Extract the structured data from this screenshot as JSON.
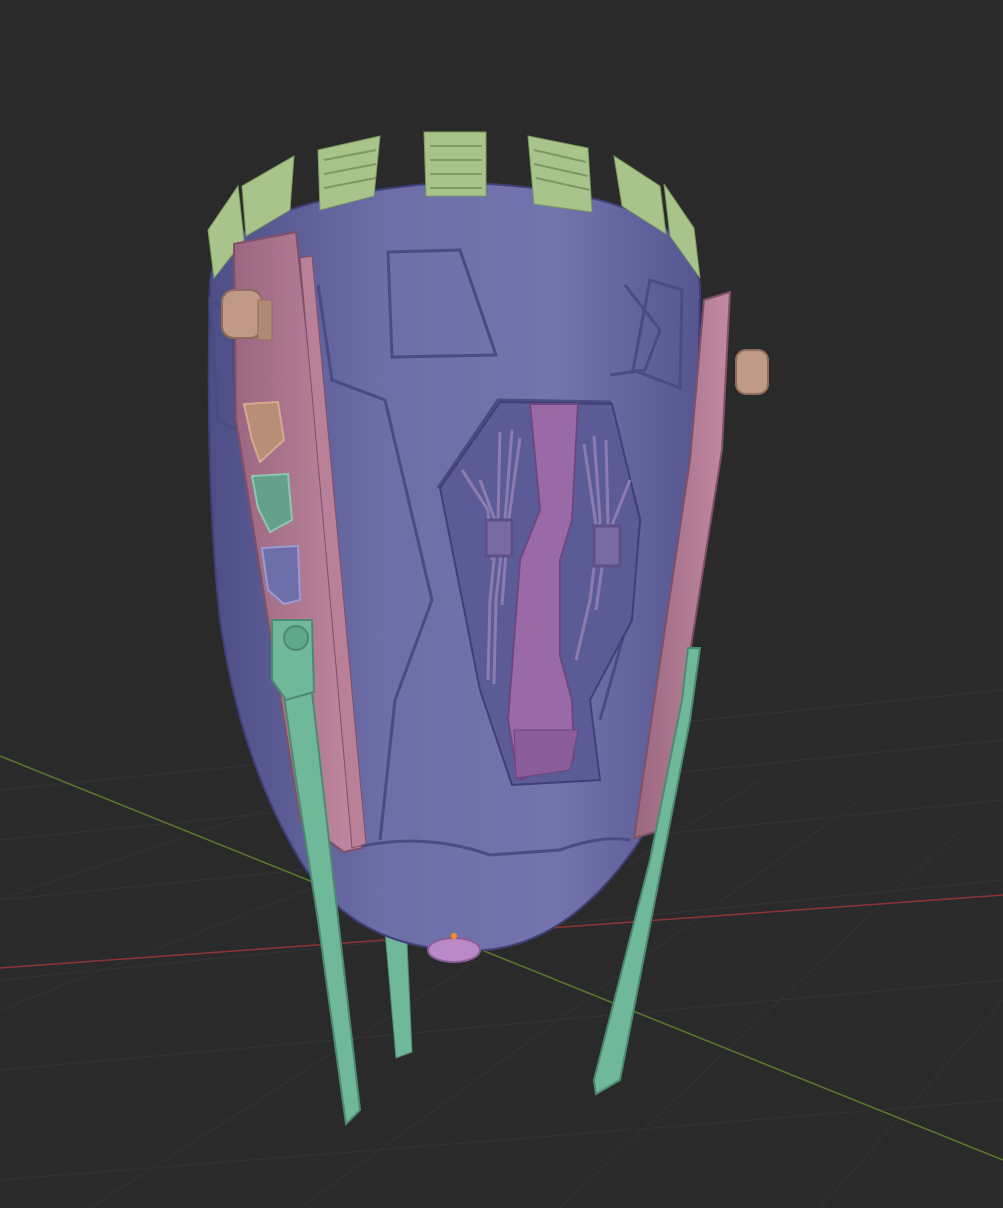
{
  "app": {
    "view": "3d-viewport",
    "background_color": "#2a2a2a"
  },
  "viewport": {
    "grid": true,
    "axes": [
      "x-axis-red",
      "y-axis-green"
    ]
  },
  "model": {
    "name": "",
    "parts": [
      {
        "part": "pod-body",
        "color": "#6e6fa8"
      },
      {
        "part": "top-vent-fins",
        "color": "#a8c48a"
      },
      {
        "part": "side-rails",
        "color": "#b07890"
      },
      {
        "part": "landing-legs",
        "color": "#6fb89a"
      },
      {
        "part": "center-arm",
        "color": "#9a6aa6"
      },
      {
        "part": "cable-bundles",
        "color": "#8a7aac"
      },
      {
        "part": "side-thrusters",
        "color": "#c09a86"
      },
      {
        "part": "origin-point",
        "color": "#ff8a1f"
      }
    ]
  },
  "colors": {
    "grid_line": "#333333",
    "x_axis": "#9a3a3a",
    "y_axis": "#5f7d2a",
    "body": "#6e6fa8",
    "body_shadow": "#4e4f85",
    "fins": "#a8c48a",
    "rails": "#b07890",
    "legs": "#6fb89a",
    "arm": "#9a6aa6",
    "thruster": "#c09a86",
    "origin": "#ff8a1f"
  }
}
